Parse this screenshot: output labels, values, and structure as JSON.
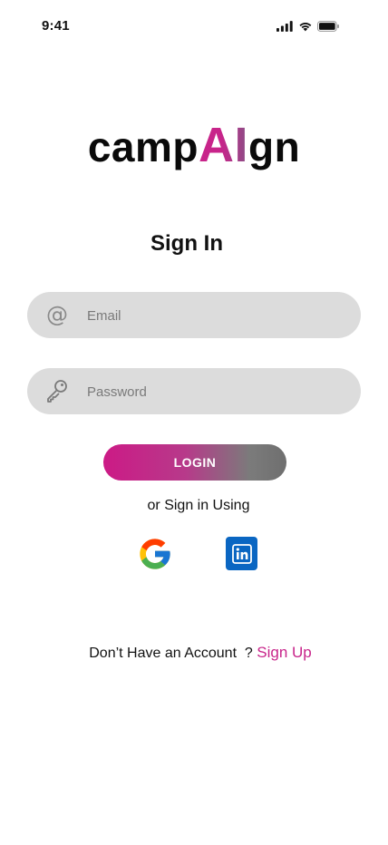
{
  "status_bar": {
    "time": "9:41",
    "icons": [
      "signal-icon",
      "wifi-icon",
      "battery-icon"
    ]
  },
  "logo": {
    "prefix": "camp",
    "highlight": "AI",
    "suffix": "gn",
    "highlight_color": "#c8248a"
  },
  "page_title": "Sign In",
  "form": {
    "email": {
      "placeholder": "Email",
      "value": "",
      "icon": "at-icon"
    },
    "password": {
      "placeholder": "Password",
      "value": "",
      "icon": "key-icon"
    },
    "login_label": "LOGIN"
  },
  "alt_signin": {
    "label": "or Sign in Using",
    "providers": [
      "google-icon",
      "linkedin-icon"
    ]
  },
  "signup": {
    "prompt": "Don’t Have an Account  ? ",
    "link_label": "Sign Up"
  },
  "colors": {
    "accent": "#c8248a",
    "input_bg": "#dcdcdc",
    "linkedin": "#0a66c2"
  }
}
